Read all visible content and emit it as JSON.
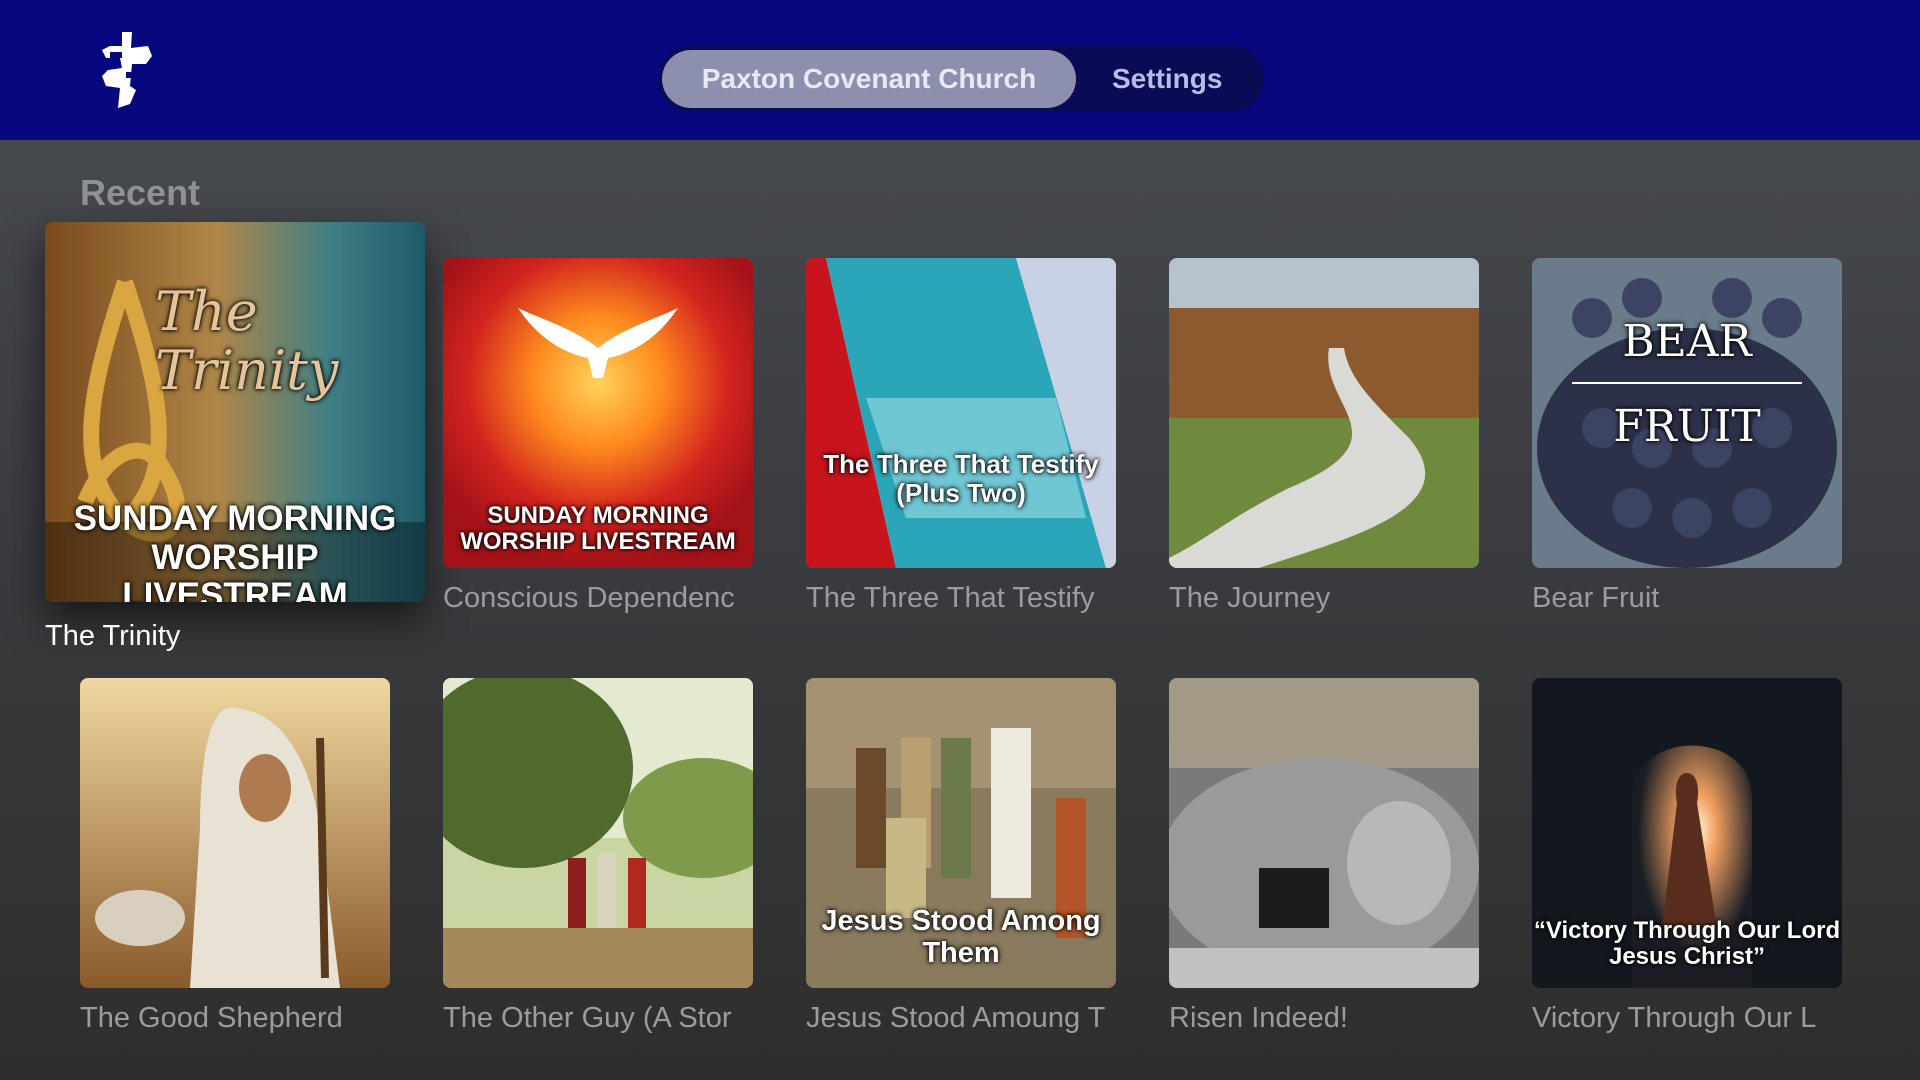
{
  "header": {
    "logo": "cross-logo-icon",
    "tabs": [
      {
        "label": "Paxton Covenant Church",
        "active": true
      },
      {
        "label": "Settings",
        "active": false
      }
    ]
  },
  "section": {
    "title": "Recent"
  },
  "tiles": [
    {
      "title": "The Trinity",
      "art_title": "The Trinity",
      "art_caption": "SUNDAY MORNING WORSHIP LIVESTREAM",
      "focused": true
    },
    {
      "title": "Conscious Dependenc",
      "art_caption": "SUNDAY MORNING WORSHIP LIVESTREAM"
    },
    {
      "title": "The Three That Testify",
      "art_caption": "The Three That Testify (Plus Two)"
    },
    {
      "title": "The Journey"
    },
    {
      "title": "Bear Fruit",
      "art_title_1": "BEAR",
      "art_title_2": "FRUIT"
    },
    {
      "title": "The Good Shepherd"
    },
    {
      "title": "The Other Guy (A Stor"
    },
    {
      "title": "Jesus Stood Amoung T",
      "art_caption": "Jesus Stood Among Them"
    },
    {
      "title": "Risen Indeed!"
    },
    {
      "title": "Victory Through Our L",
      "art_caption": "“Victory Through Our Lord Jesus Christ”"
    }
  ]
}
